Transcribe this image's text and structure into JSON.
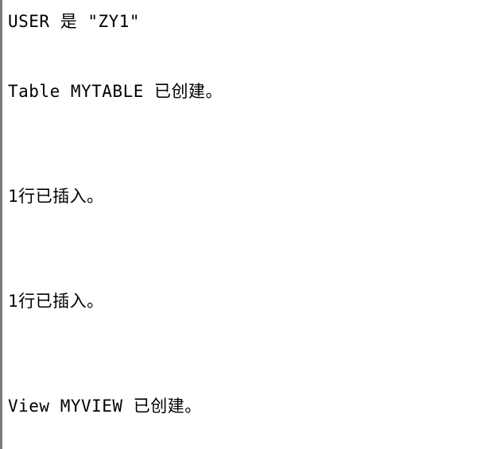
{
  "console": {
    "lines": [
      "USER 是 \"ZY1\"",
      "Table MYTABLE 已创建。",
      "1行已插入。",
      "1行已插入。",
      "View MYVIEW 已创建。"
    ]
  }
}
